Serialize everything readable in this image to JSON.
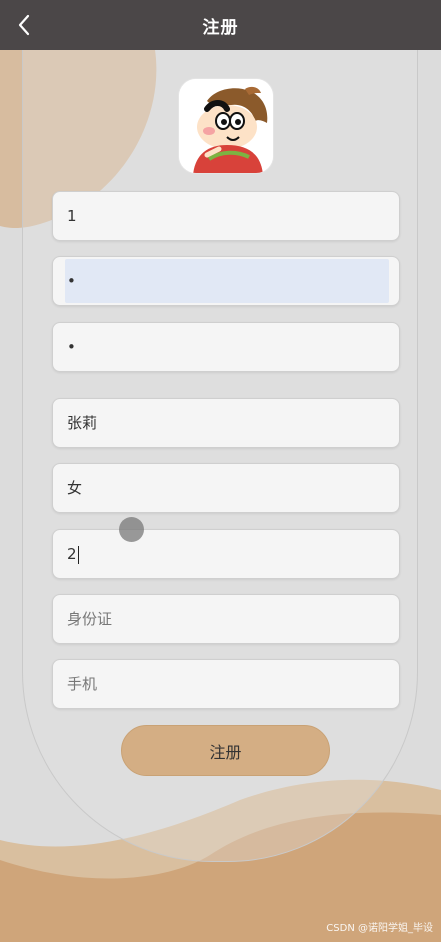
{
  "header": {
    "title": "注册",
    "back_icon": "chevron-left-icon"
  },
  "avatar": {
    "icon": "cartoon-avatar-icon"
  },
  "form": {
    "username": "1",
    "password": "•",
    "confirm_password": "•",
    "name": "张莉",
    "gender": "女",
    "age": "2",
    "id_card_placeholder": "身份证",
    "phone_placeholder": "手机"
  },
  "submit_label": "注册",
  "watermark": "CSDN @诺阳学姐_毕设",
  "colors": {
    "header_bg": "#4b4748",
    "accent": "#d4ae84",
    "background": "#dcdcdc",
    "autofill": "#e1e8f5"
  }
}
